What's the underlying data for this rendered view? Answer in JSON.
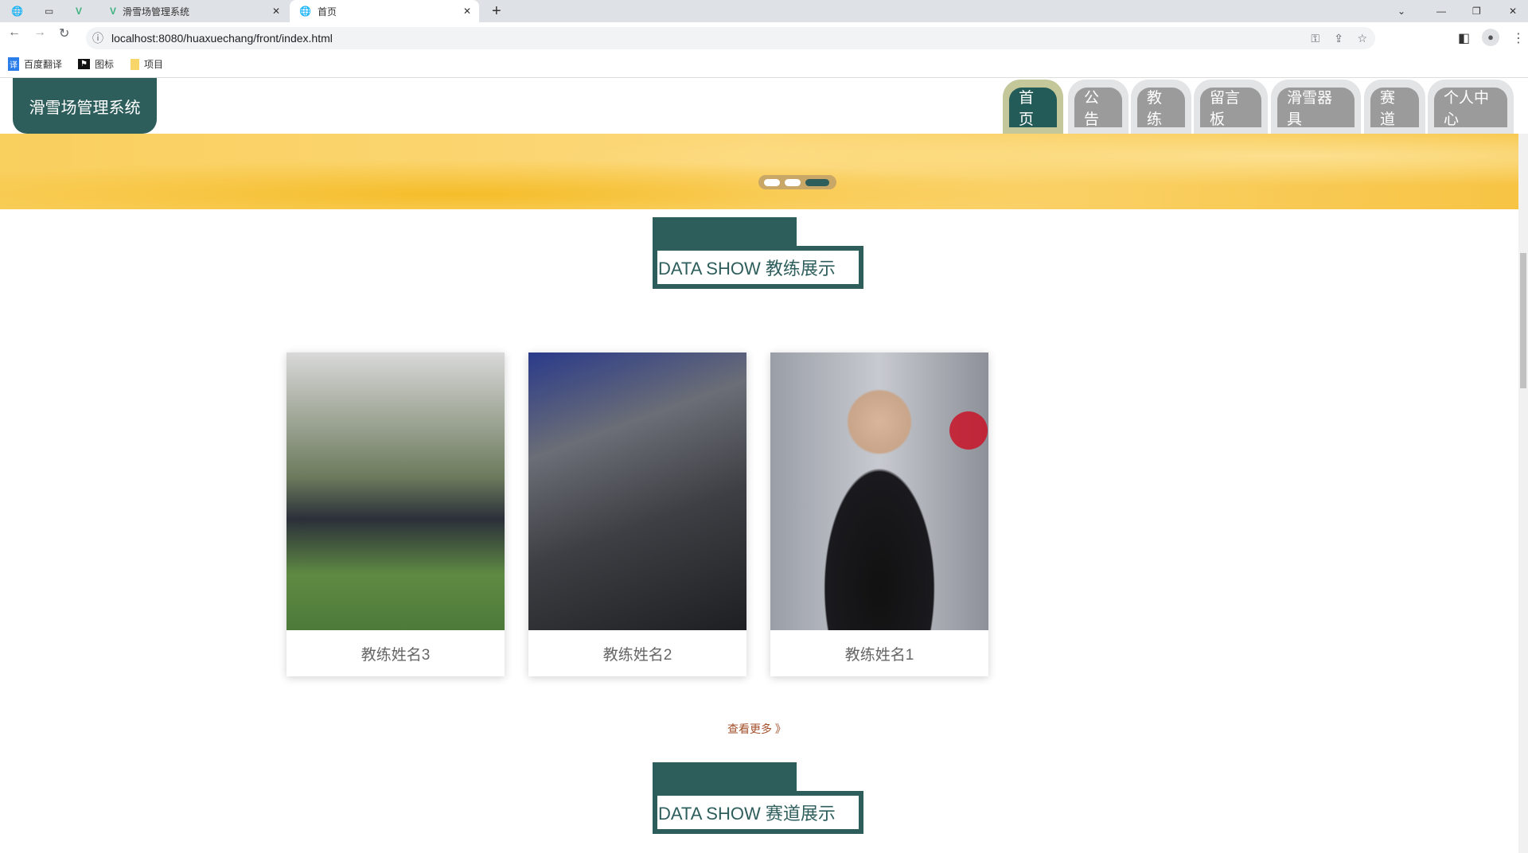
{
  "browser": {
    "tabs": [
      {
        "title": "滑雪场管理系统"
      },
      {
        "title": "首页"
      }
    ],
    "url": "localhost:8080/huaxuechang/front/index.html",
    "bookmarks": [
      "百度翻译",
      "图标",
      "项目"
    ]
  },
  "header": {
    "logo": "滑雪场管理系统",
    "nav": [
      "首页",
      "公告",
      "教练",
      "留言板",
      "滑雪器具",
      "赛道",
      "个人中心"
    ],
    "active_nav": "首页"
  },
  "carousel": {
    "slide_count": 3,
    "active_index": 3
  },
  "coach_section": {
    "title": "DATA SHOW 教练展示",
    "cards": [
      {
        "name": "教练姓名3"
      },
      {
        "name": "教练姓名2"
      },
      {
        "name": "教练姓名1"
      }
    ],
    "more": "查看更多 》"
  },
  "track_section": {
    "title": "DATA SHOW 赛道展示"
  },
  "colors": {
    "primary": "#2e5e5c",
    "nav_inactive": "#9b9b9b",
    "more_link": "#a3502c"
  }
}
